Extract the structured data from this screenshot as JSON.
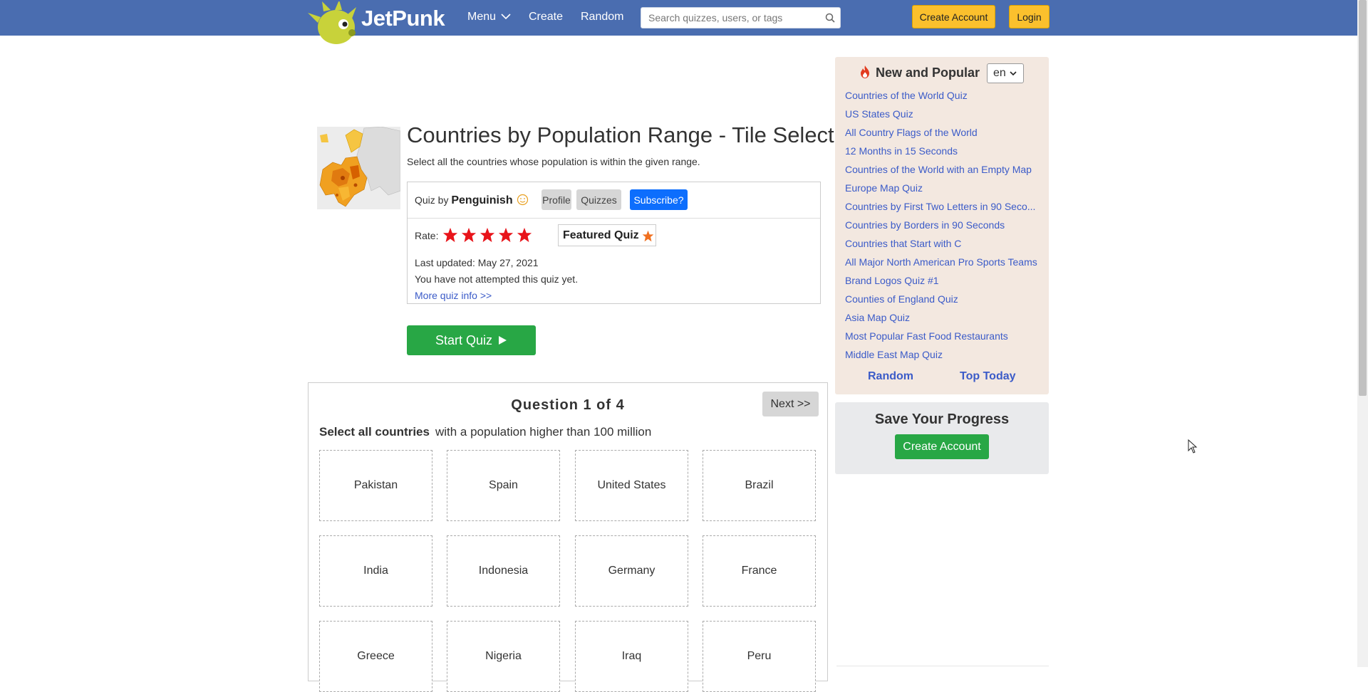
{
  "header": {
    "logo_text": "JetPunk",
    "nav": {
      "menu": "Menu",
      "create": "Create",
      "random": "Random"
    },
    "search": {
      "placeholder": "Search quizzes, users, or tags"
    },
    "create_account": "Create Account",
    "login": "Login",
    "bar_color": "#4a6db0"
  },
  "quiz": {
    "title": "Countries by Population Range - Tile Select",
    "description": "Select all the countries whose population is within the given range.",
    "quiz_by_label": "Quiz by",
    "author": "Penguinish",
    "profile": "Profile",
    "quizzes": "Quizzes",
    "subscribe": "Subscribe?",
    "rate_label": "Rate:",
    "star_count": 5,
    "featured": "Featured Quiz",
    "last_updated": "Last updated: May 27, 2021",
    "attempt_status": "You have not attempted this quiz yet.",
    "more_info": "More quiz info >>",
    "start": "Start Quiz"
  },
  "question": {
    "header": "Question 1 of 4",
    "next": "Next >>",
    "prompt_bold": "Select all countries",
    "prompt_rest": "with a population higher than 100 million",
    "tiles": [
      "Pakistan",
      "Spain",
      "United States",
      "Brazil",
      "India",
      "Indonesia",
      "Germany",
      "France",
      "Greece",
      "Nigeria",
      "Iraq",
      "Peru"
    ]
  },
  "sidebar": {
    "heading": "New and Popular",
    "language": "en",
    "links": [
      "Countries of the World Quiz",
      "US States Quiz",
      "All Country Flags of the World",
      "12 Months in 15 Seconds",
      "Countries of the World with an Empty Map",
      "Europe Map Quiz",
      "Countries by First Two Letters in 90 Seco...",
      "Countries by Borders in 90 Seconds",
      "Countries that Start with C",
      "All Major North American Pro Sports Teams",
      "Brand Logos Quiz #1",
      "Counties of England Quiz",
      "Asia Map Quiz",
      "Most Popular Fast Food Restaurants",
      "Middle East Map Quiz"
    ],
    "random": "Random",
    "top_today": "Top Today",
    "save_title": "Save Your Progress",
    "save_button": "Create Account"
  }
}
